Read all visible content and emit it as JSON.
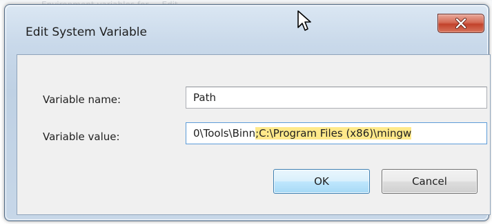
{
  "background": {
    "partial_text": "Environment variables for ...  Edit ..."
  },
  "dialog": {
    "title": "Edit System Variable",
    "close_glyph": "x",
    "name_label": "Variable name:",
    "name_value": "Path",
    "value_label": "Variable value:",
    "value_plain": "0\\Tools\\Binn",
    "value_highlighted": ";C:\\Program Files (x86)\\mingw",
    "ok_label": "OK",
    "cancel_label": "Cancel"
  },
  "icons": {
    "close": "close-icon",
    "cursor": "mouse-cursor-icon"
  },
  "colors": {
    "highlight": "#ffe98a",
    "close_button": "#c2422b",
    "ok_border": "#3c7fb1"
  }
}
